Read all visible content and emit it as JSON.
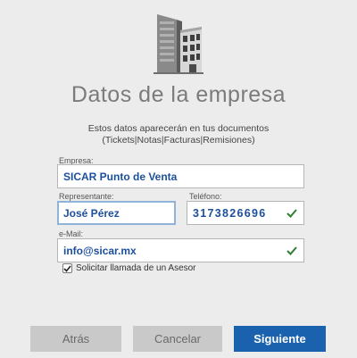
{
  "header": {
    "title": "Datos de la empresa",
    "subtitle_line1": "Estos datos aparecerán en tus documentos",
    "subtitle_line2": "(Tickets|Notas|Facturas|Remisiones)"
  },
  "form": {
    "empresa": {
      "label": "Empresa:",
      "value": "SICAR Punto de Venta"
    },
    "representante": {
      "label": "Representante:",
      "value": "José Pérez"
    },
    "telefono": {
      "label": "Teléfono:",
      "value": "3173826696",
      "valid_icon": "check-icon"
    },
    "email": {
      "label": "e-Mail:",
      "value": "info@sicar.mx",
      "valid_icon": "check-icon"
    },
    "solicitar": {
      "label": "Solicitar llamada de un Asesor",
      "checked": true
    }
  },
  "buttons": {
    "back_label": "Atrás",
    "cancel_label": "Cancelar",
    "next_label": "Siguiente"
  },
  "colors": {
    "accent": "#1a62ad",
    "field_text": "#1c4f9b",
    "valid_check": "#2e7d32",
    "focus_border": "#8fb4d8",
    "background": "#ececec"
  }
}
